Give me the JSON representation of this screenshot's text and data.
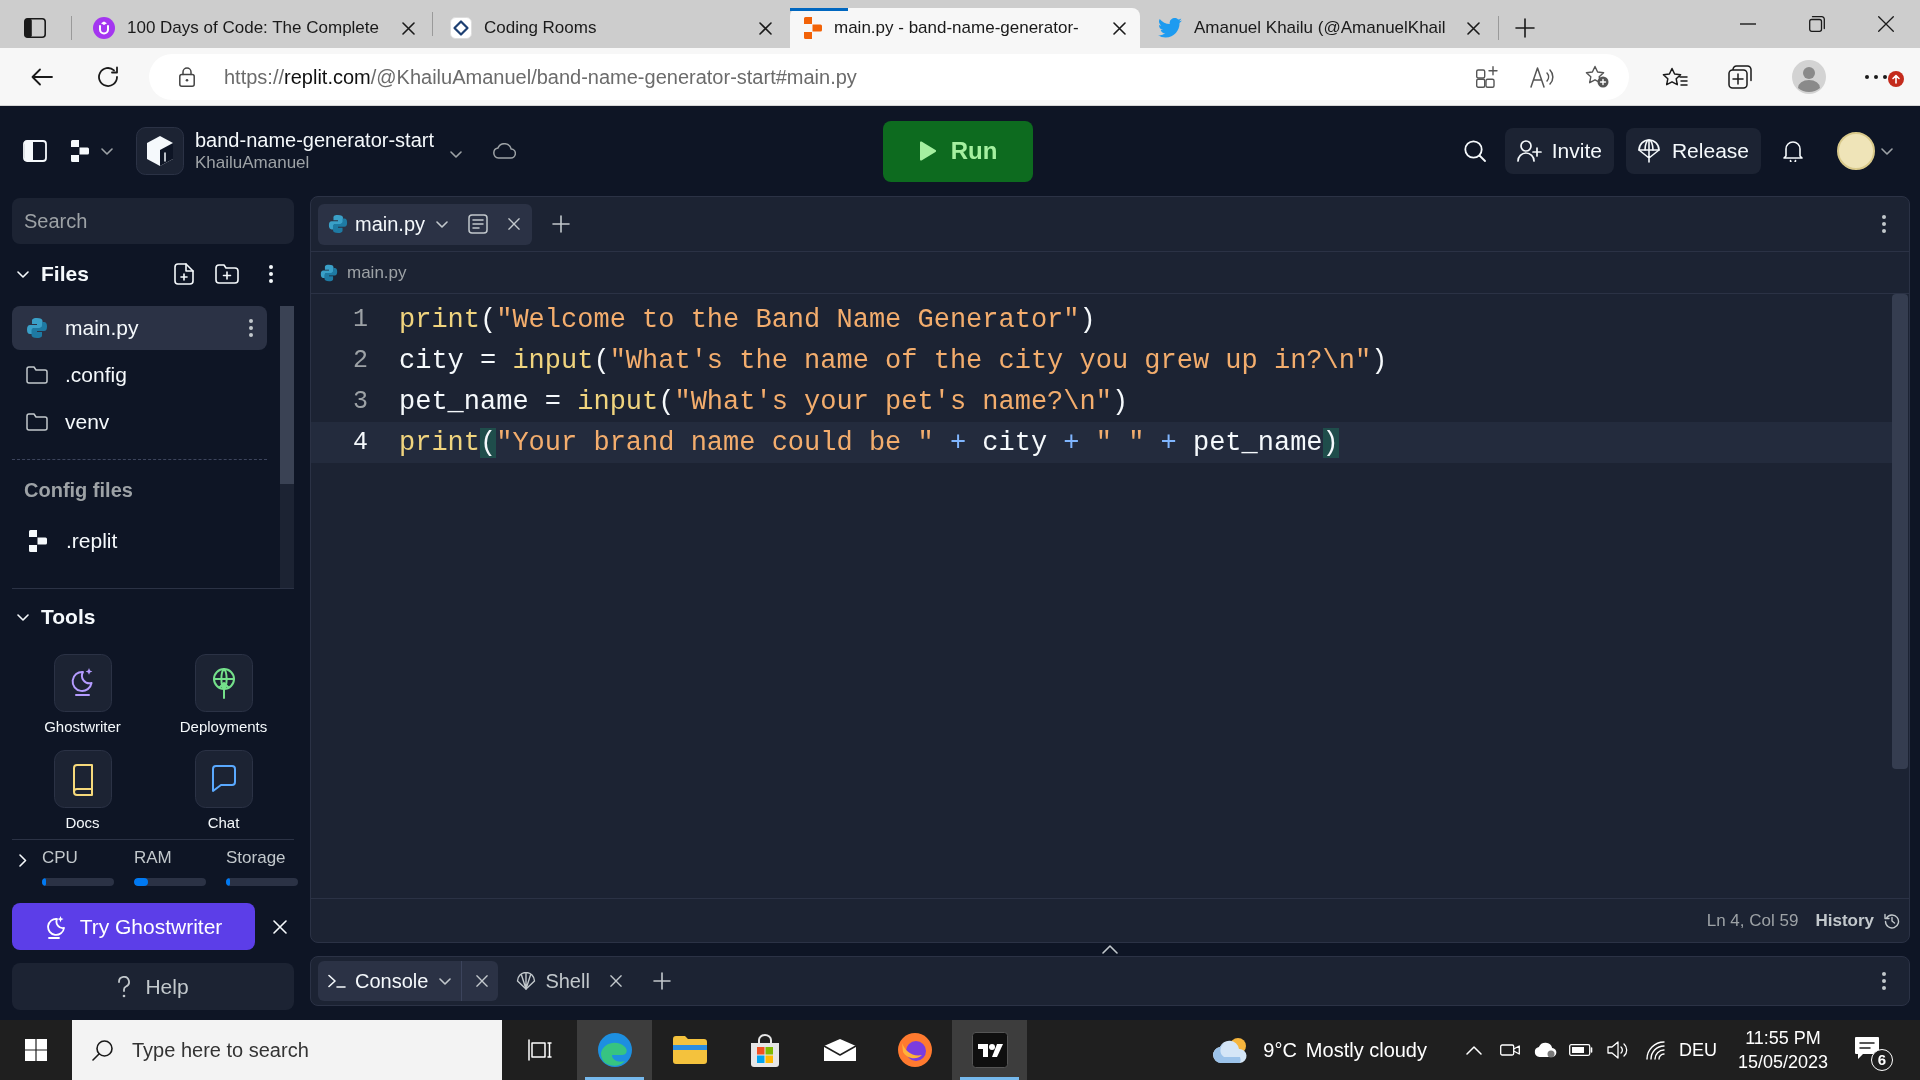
{
  "browser": {
    "tabs": [
      {
        "title": "100 Days of Code: The Complete",
        "kind": "udemy",
        "selected": false
      },
      {
        "title": "Coding Rooms",
        "kind": "codingrooms",
        "selected": false
      },
      {
        "title": "main.py - band-name-generator-",
        "kind": "replit",
        "selected": true
      },
      {
        "title": "Amanuel Khailu (@AmanuelKhail",
        "kind": "twitter",
        "selected": false
      }
    ],
    "address": {
      "scheme": "https://",
      "host": "replit.com",
      "path": "/@KhailuAmanuel/band-name-generator-start#main.py"
    }
  },
  "header": {
    "project": "band-name-generator-start",
    "owner": "KhailuAmanuel",
    "run_button": "Run",
    "invite_button": "Invite",
    "release_button": "Release"
  },
  "sidebar": {
    "search": {
      "placeholder": "Search"
    },
    "files": {
      "title": "Files",
      "expanded": true,
      "items": [
        {
          "name": "main.py",
          "kind": "python",
          "selected": true
        },
        {
          "name": ".config",
          "kind": "folder",
          "selected": false
        },
        {
          "name": "venv",
          "kind": "folder",
          "selected": false
        }
      ]
    },
    "config_files": {
      "title": "Config files",
      "items": [
        {
          "name": ".replit",
          "kind": "replit"
        }
      ]
    },
    "tools": {
      "title": "Tools",
      "expanded": true,
      "items": [
        {
          "label": "Ghostwriter",
          "kind": "ghostwriter"
        },
        {
          "label": "Deployments",
          "kind": "deployments"
        },
        {
          "label": "Docs",
          "kind": "docs"
        },
        {
          "label": "Chat",
          "kind": "chat"
        }
      ]
    },
    "resources": {
      "expanded": false,
      "meters": [
        {
          "label": "CPU",
          "level": 0.05
        },
        {
          "label": "RAM",
          "level": 0.2
        },
        {
          "label": "Storage",
          "level": 0.05
        }
      ]
    },
    "promo": {
      "label": "Try Ghostwriter"
    },
    "help": {
      "label": "Help"
    }
  },
  "editor": {
    "tabs": [
      {
        "label": "main.py",
        "selected": true
      }
    ],
    "breadcrumb": "main.py",
    "lines": [
      {
        "number": "1",
        "current": false,
        "tokens": [
          {
            "kind": "function",
            "text": "print"
          },
          {
            "kind": "plain",
            "text": "("
          },
          {
            "kind": "string",
            "text": "\"Welcome to the Band Name Generator\""
          },
          {
            "kind": "plain",
            "text": ")"
          }
        ]
      },
      {
        "number": "2",
        "current": false,
        "tokens": [
          {
            "kind": "plain",
            "text": "city = "
          },
          {
            "kind": "function",
            "text": "input"
          },
          {
            "kind": "plain",
            "text": "("
          },
          {
            "kind": "string",
            "text": "\"What's the name of the city you grew up in?\\n\""
          },
          {
            "kind": "plain",
            "text": ")"
          }
        ]
      },
      {
        "number": "3",
        "current": false,
        "tokens": [
          {
            "kind": "plain",
            "text": "pet_name = "
          },
          {
            "kind": "function",
            "text": "input"
          },
          {
            "kind": "plain",
            "text": "("
          },
          {
            "kind": "string",
            "text": "\"What's your pet's name?\\n\""
          },
          {
            "kind": "plain",
            "text": ")"
          }
        ]
      },
      {
        "number": "4",
        "current": true,
        "tokens": [
          {
            "kind": "function",
            "text": "print"
          },
          {
            "kind": "matched",
            "text": "("
          },
          {
            "kind": "string",
            "text": "\"Your brand name could be \""
          },
          {
            "kind": "operator",
            "text": " + "
          },
          {
            "kind": "plain",
            "text": "city"
          },
          {
            "kind": "operator",
            "text": " + "
          },
          {
            "kind": "string",
            "text": "\" \""
          },
          {
            "kind": "operator",
            "text": " + "
          },
          {
            "kind": "plain",
            "text": "pet_name"
          },
          {
            "kind": "matched",
            "text": ")"
          }
        ]
      }
    ],
    "status": {
      "position": "Ln 4, Col 59",
      "history": "History"
    }
  },
  "console": {
    "tabs": [
      {
        "label": "Console",
        "kind": "console",
        "selected": true
      },
      {
        "label": "Shell",
        "kind": "shell",
        "selected": false
      }
    ]
  },
  "taskbar": {
    "search": {
      "placeholder": "Type here to search"
    },
    "apps": [
      {
        "kind": "taskview",
        "running": false
      },
      {
        "kind": "edge",
        "running": true
      },
      {
        "kind": "explorer",
        "running": false
      },
      {
        "kind": "store",
        "running": false
      },
      {
        "kind": "mail",
        "running": false
      },
      {
        "kind": "firefox",
        "running": false
      },
      {
        "kind": "tradingview",
        "running": true
      }
    ],
    "weather": {
      "temperature": "9°C",
      "condition": "Mostly cloudy"
    },
    "language": "DEU",
    "time": "11:55 PM",
    "date": "15/05/2023",
    "notifications": "6"
  }
}
